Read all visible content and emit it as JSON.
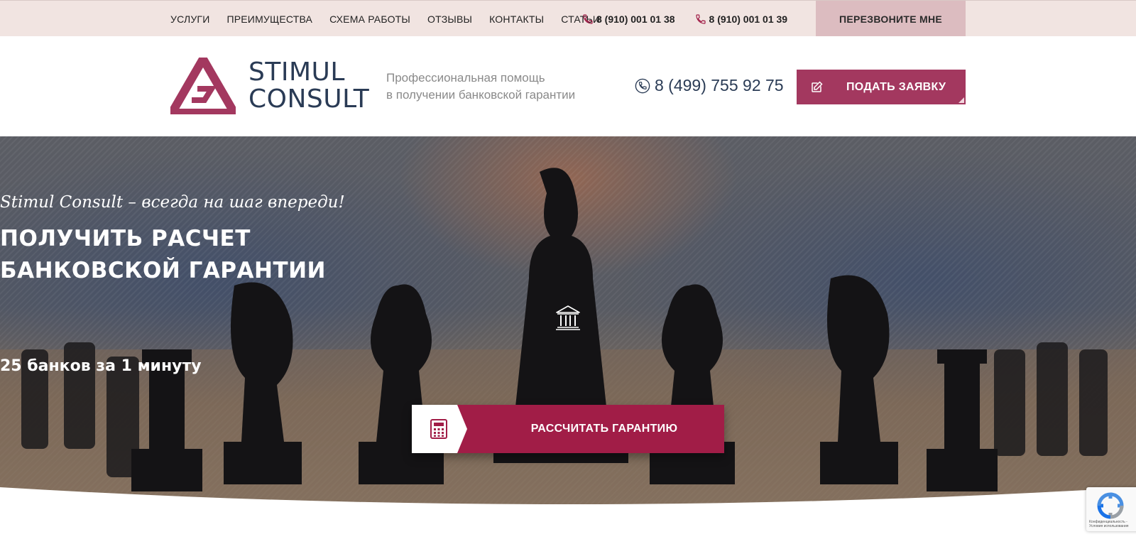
{
  "topbar": {
    "nav": [
      {
        "label": "УСЛУГИ"
      },
      {
        "label": "ПРЕИМУЩЕСТВА"
      },
      {
        "label": "СХЕМА РАБОТЫ"
      },
      {
        "label": "ОТЗЫВЫ"
      },
      {
        "label": "КОНТАКТЫ"
      },
      {
        "label": "СТАТЬИ"
      }
    ],
    "phones": [
      "8 (910) 001 01 38",
      "8 (910) 001 01 39"
    ],
    "callback_label": "ПЕРЕЗВОНИТЕ МНЕ"
  },
  "header": {
    "logo_line1": "STIMUL",
    "logo_line2": "CONSULT",
    "tagline_line1": "Профессиональная помощь",
    "tagline_line2": "в получении банковской гарантии",
    "phone": "8 (499) 755 92 75",
    "apply_label": "ПОДАТЬ ЗАЯВКУ"
  },
  "hero": {
    "slogan": "Stimul Consult – всегда на шаг впереди!",
    "title_line1": "ПОЛУЧИТЬ РАСЧЕТ",
    "title_line2": "БАНКОВСКОЙ ГАРАНТИИ",
    "banks_line": "25 банков за 1 минуту",
    "calc_label": "РАССЧИТАТЬ ГАРАНТИЮ"
  },
  "recaptcha": {
    "text": "Конфиденциальность - Условия использования"
  },
  "colors": {
    "brand": "#a11d47",
    "brand_light": "#a3385f",
    "navy": "#2a3b55",
    "topbar_bg": "#f1e4e1",
    "callback_bg": "#dcbcc0"
  },
  "icons": [
    "phone-icon",
    "edit-icon",
    "bank-icon",
    "calculator-icon",
    "recaptcha-icon"
  ]
}
